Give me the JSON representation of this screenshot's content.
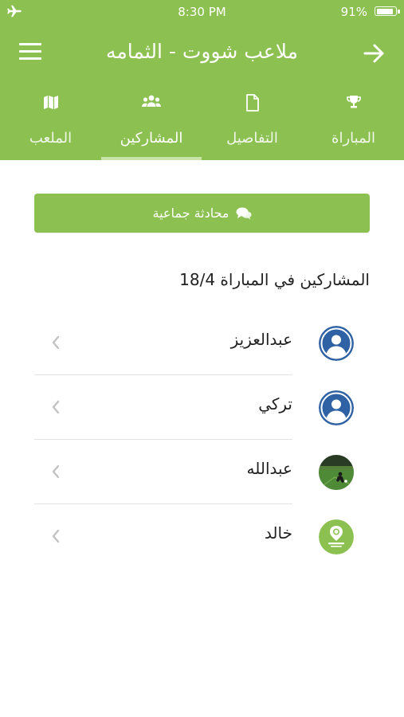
{
  "status_bar": {
    "time": "8:30 PM",
    "battery": "91%",
    "battery_level": 0.91
  },
  "navbar": {
    "title": "ملاعب شووت - الثمامه",
    "back_icon": "arrow-right-icon",
    "menu_icon": "hamburger-menu-icon"
  },
  "tabs": [
    {
      "label": "المباراة",
      "icon": "trophy-icon"
    },
    {
      "label": "التفاصيل",
      "icon": "document-icon"
    },
    {
      "label": "المشاركين",
      "icon": "users-icon",
      "active": true
    },
    {
      "label": "الملعب",
      "icon": "map-icon"
    }
  ],
  "chat_button": {
    "label": "محادثة جماعية",
    "icon": "chat-bubbles-icon"
  },
  "participants_title": "المشاركين في المباراة 18/4",
  "participants": [
    {
      "name": "عبدالعزيز",
      "avatar": "default-user-avatar"
    },
    {
      "name": "تركي",
      "avatar": "default-user-avatar"
    },
    {
      "name": "عبدالله",
      "avatar": "photo-avatar"
    },
    {
      "name": "خالد",
      "avatar": "logo-avatar"
    }
  ],
  "colors": {
    "accent": "#8cc152",
    "avatar_blue": "#2f62a4",
    "tab_underline": "#c8e3a8"
  }
}
